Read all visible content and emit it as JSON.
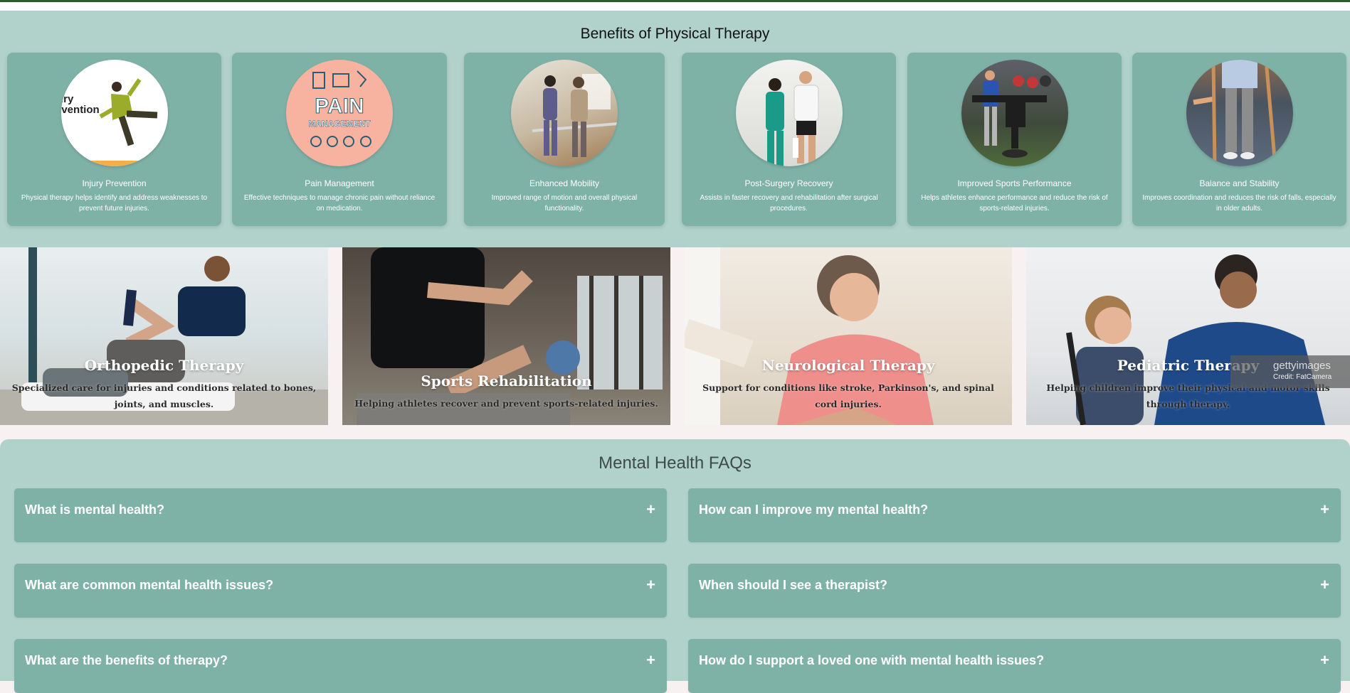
{
  "benefits": {
    "heading": "Benefits of Physical Therapy",
    "cards": [
      {
        "title": "Injury Prevention",
        "desc": "Physical therapy helps identify and address weaknesses to prevent future injuries.",
        "image_text": "Injury Prevention",
        "image_bg": "#ffffff"
      },
      {
        "title": "Pain Management",
        "desc": "Effective techniques to manage chronic pain without reliance on medication.",
        "image_text_1": "PAIN",
        "image_text_2": "MANAGEMENT",
        "image_bg": "#f7b3a0"
      },
      {
        "title": "Enhanced Mobility",
        "desc": "Improved range of motion and overall physical functionality."
      },
      {
        "title": "Post-Surgery Recovery",
        "desc": "Assists in faster recovery and rehabilitation after surgical procedures."
      },
      {
        "title": "Improved Sports Performance",
        "desc": "Helps athletes enhance performance and reduce the risk of sports-related injuries."
      },
      {
        "title": "Balance and Stability",
        "desc": "Improves coordination and reduces the risk of falls, especially in older adults."
      }
    ]
  },
  "specialties": [
    {
      "title": "Orthopedic Therapy",
      "desc": "Specialized care for injuries and conditions related to bones, joints, and muscles."
    },
    {
      "title": "Sports Rehabilitation",
      "desc": "Helping athletes recover and prevent sports-related injuries."
    },
    {
      "title": "Neurological Therapy",
      "desc": "Support for conditions like stroke, Parkinson's, and spinal cord injuries."
    },
    {
      "title": "Pediatric Therapy",
      "desc": "Helping children improve their physical and motor skills through therapy."
    }
  ],
  "watermark": {
    "brand": "gettyimages",
    "credit": "Credit: FatCamera"
  },
  "faq": {
    "heading": "Mental Health FAQs",
    "items": [
      {
        "q": "What is mental health?",
        "icon": "plus-icon"
      },
      {
        "q": "How can I improve my mental health?",
        "icon": "plus-icon"
      },
      {
        "q": "What are common mental health issues?",
        "icon": "plus-icon"
      },
      {
        "q": "When should I see a therapist?",
        "icon": "plus-icon"
      },
      {
        "q": "What are the benefits of therapy?",
        "icon": "plus-icon"
      },
      {
        "q": "How do I support a loved one with mental health issues?",
        "icon": "plus-icon"
      }
    ],
    "toggle_symbol": "+"
  }
}
